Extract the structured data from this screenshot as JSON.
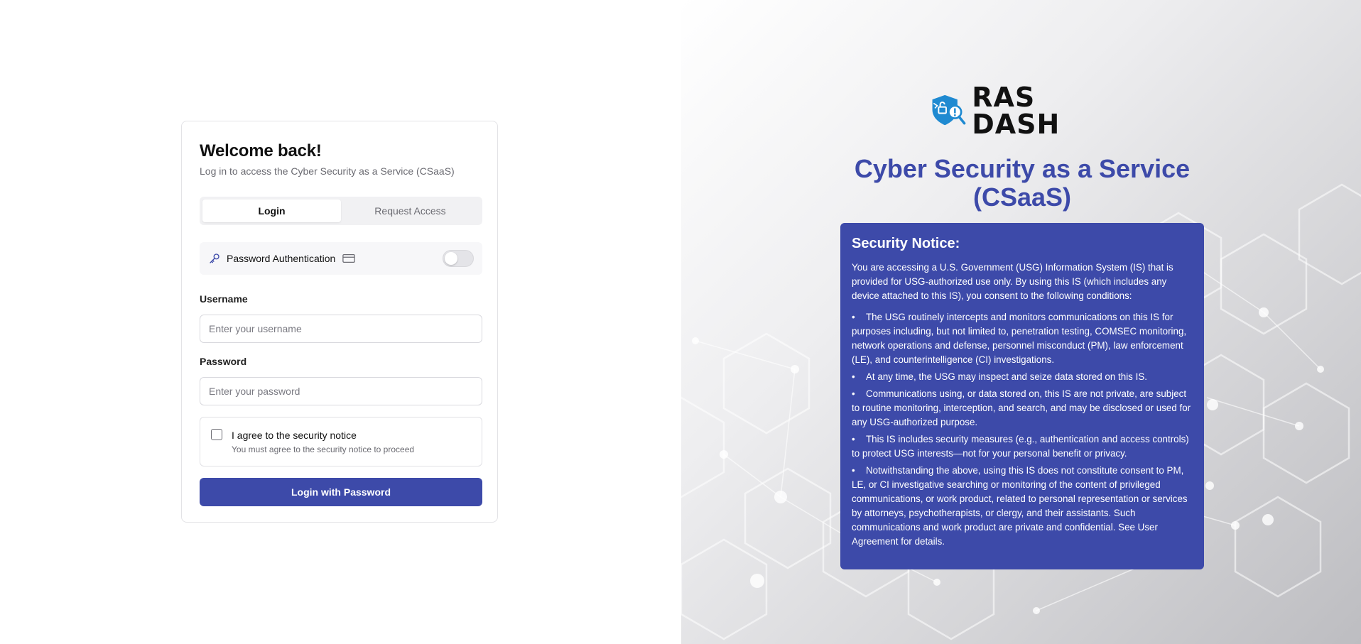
{
  "login_card": {
    "title": "Welcome back!",
    "subtitle": "Log in to access the Cyber Security as a Service (CSaaS)",
    "tabs": [
      {
        "label": "Login",
        "active": true
      },
      {
        "label": "Request Access",
        "active": false
      }
    ],
    "auth_mode": {
      "label": "Password Authentication",
      "key_icon": "key-icon",
      "alt_icon": "credit-card-icon",
      "toggle_on": false
    },
    "username": {
      "label": "Username",
      "placeholder": "Enter your username",
      "value": ""
    },
    "password": {
      "label": "Password",
      "placeholder": "Enter your password",
      "value": ""
    },
    "agree": {
      "label": "I agree to the security notice",
      "hint": "You must agree to the security notice to proceed",
      "checked": false
    },
    "submit_label": "Login with Password"
  },
  "branding": {
    "logo_text": "RAS DASH",
    "logo_icon": "shield-magnifier-icon",
    "hero_title": "Cyber Security as a Service (CSaaS)"
  },
  "notice": {
    "title": "Security Notice:",
    "intro": "You are accessing a U.S. Government (USG) Information System (IS) that is provided for USG-authorized use only. By using this IS (which includes any device attached to this IS), you consent to the following conditions:",
    "bullets": [
      "The USG routinely intercepts and monitors communications on this IS for purposes including, but not limited to, penetration testing, COMSEC monitoring, network operations and defense, personnel misconduct (PM), law enforcement (LE), and counterintelligence (CI) investigations.",
      "At any time, the USG may inspect and seize data stored on this IS.",
      "Communications using, or data stored on, this IS are not private, are subject to routine monitoring, interception, and search, and may be disclosed or used for any USG-authorized purpose.",
      "This IS includes security measures (e.g., authentication and access controls) to protect USG interests—not for your personal benefit or privacy.",
      "Notwithstanding the above, using this IS does not constitute consent to PM, LE, or CI investigative searching or monitoring of the content of privileged communications, or work product, related to personal representation or services by attorneys, psychotherapists, or clergy, and their assistants. Such communications and work product are private and confidential. See User Agreement for details."
    ]
  },
  "colors": {
    "accent": "#3d4aa9",
    "logo_blue": "#1f8ad1",
    "background_right": "#d4d4d7"
  }
}
